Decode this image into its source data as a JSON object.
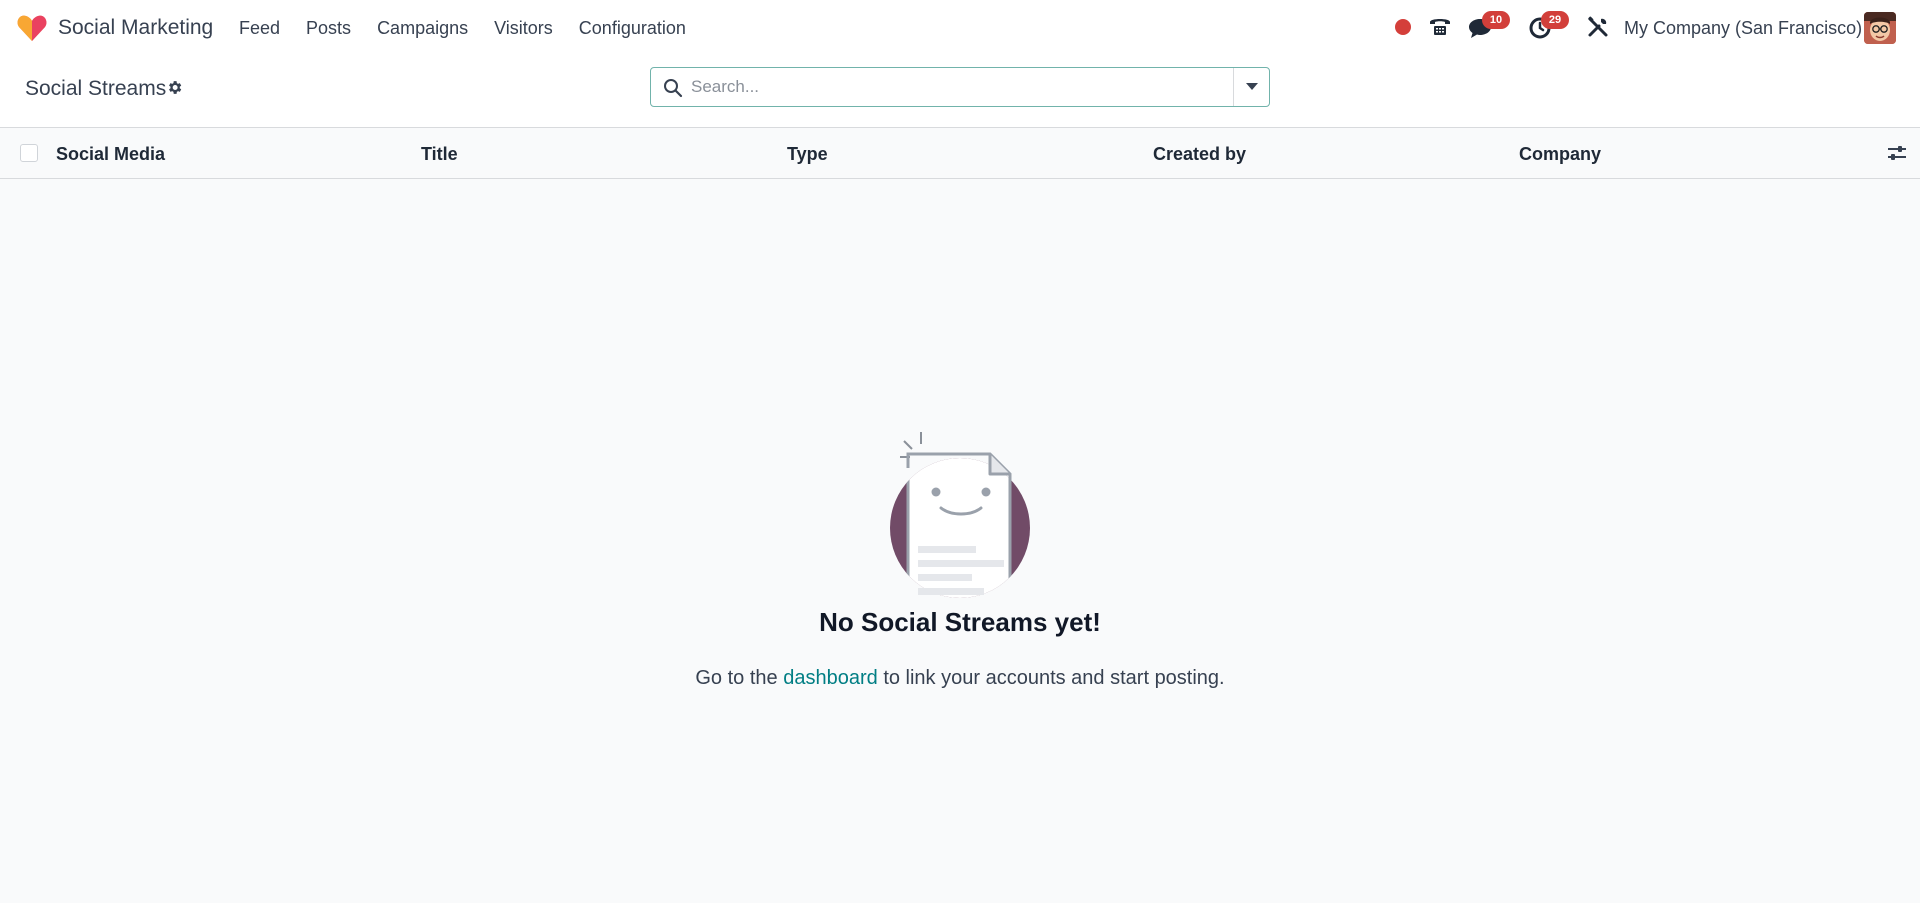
{
  "app": {
    "name": "Social Marketing",
    "brand_colors": [
      "#f06a3b",
      "#f9b233",
      "#e8356d"
    ]
  },
  "menu": {
    "items": [
      {
        "label": "Feed"
      },
      {
        "label": "Posts"
      },
      {
        "label": "Campaigns"
      },
      {
        "label": "Visitors"
      },
      {
        "label": "Configuration"
      }
    ]
  },
  "systray": {
    "recording_color": "#d43f3a",
    "messages_count": "10",
    "activities_count": "29",
    "company": "My Company (San Francisco)",
    "icons": [
      "phone-icon",
      "chat-icon",
      "clock-icon",
      "tools-icon"
    ]
  },
  "control_panel": {
    "title": "Social Streams",
    "search_placeholder": "Search..."
  },
  "list": {
    "columns": [
      "Social Media",
      "Title",
      "Type",
      "Created by",
      "Company"
    ]
  },
  "empty_state": {
    "title": "No Social Streams yet!",
    "help_prefix": "Go to the",
    "help_link": "dashboard",
    "help_suffix": "to link your accounts and start posting."
  },
  "colors": {
    "accent": "#017e84",
    "badge": "#d23f3a",
    "illustration_circle": "#714b67"
  }
}
